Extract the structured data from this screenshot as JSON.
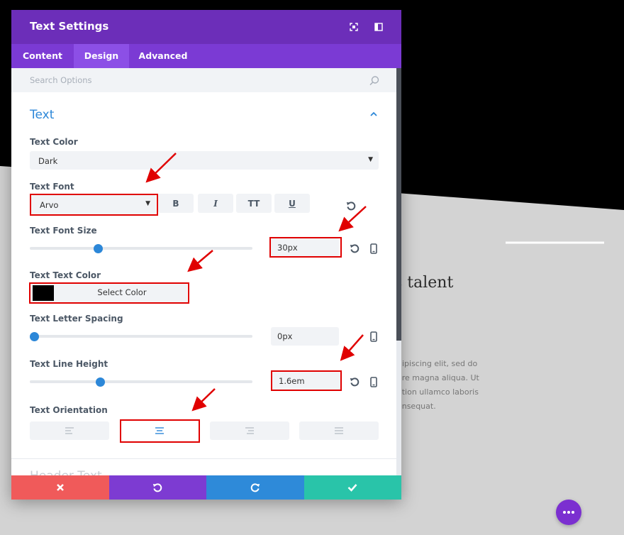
{
  "background": {
    "heading": "s talent",
    "paragraph_lines": [
      "dipiscing elit, sed do",
      "ore magna aliqua. Ut",
      "ation ullamco laboris",
      "onsequat."
    ]
  },
  "modal": {
    "title": "Text Settings",
    "tabs": [
      {
        "label": "Content",
        "active": false
      },
      {
        "label": "Design",
        "active": true
      },
      {
        "label": "Advanced",
        "active": false
      }
    ],
    "search": {
      "placeholder": "Search Options",
      "value": ""
    },
    "section_title": "Text",
    "next_section_title": "Header Text",
    "fields": {
      "text_color": {
        "label": "Text Color",
        "value": "Dark"
      },
      "text_font": {
        "label": "Text Font",
        "value": "Arvo",
        "style_buttons": [
          "B",
          "I",
          "TT",
          "U"
        ]
      },
      "font_size": {
        "label": "Text Font Size",
        "value": "30px",
        "slider_fraction": 0.3
      },
      "text_text_color": {
        "label": "Text Text Color",
        "button_label": "Select Color",
        "swatch": "#000000"
      },
      "letter_spacing": {
        "label": "Text Letter Spacing",
        "value": "0px",
        "slider_fraction": 0.0
      },
      "line_height": {
        "label": "Text Line Height",
        "value": "1.6em",
        "slider_fraction": 0.31
      },
      "orientation": {
        "label": "Text Orientation",
        "options": [
          "left",
          "center",
          "right",
          "justify"
        ],
        "selected": "center"
      }
    },
    "footer": {
      "buttons": [
        {
          "action": "cancel",
          "color": "#f05a5a"
        },
        {
          "action": "undo",
          "color": "#7d3bd2"
        },
        {
          "action": "redo",
          "color": "#2e8ad9"
        },
        {
          "action": "save",
          "color": "#29c4a9"
        }
      ]
    }
  },
  "colors": {
    "header": "#6c2eb9",
    "tabs": "#7b3ad4",
    "accent": "#2c87d8",
    "highlight": "#e00000"
  }
}
